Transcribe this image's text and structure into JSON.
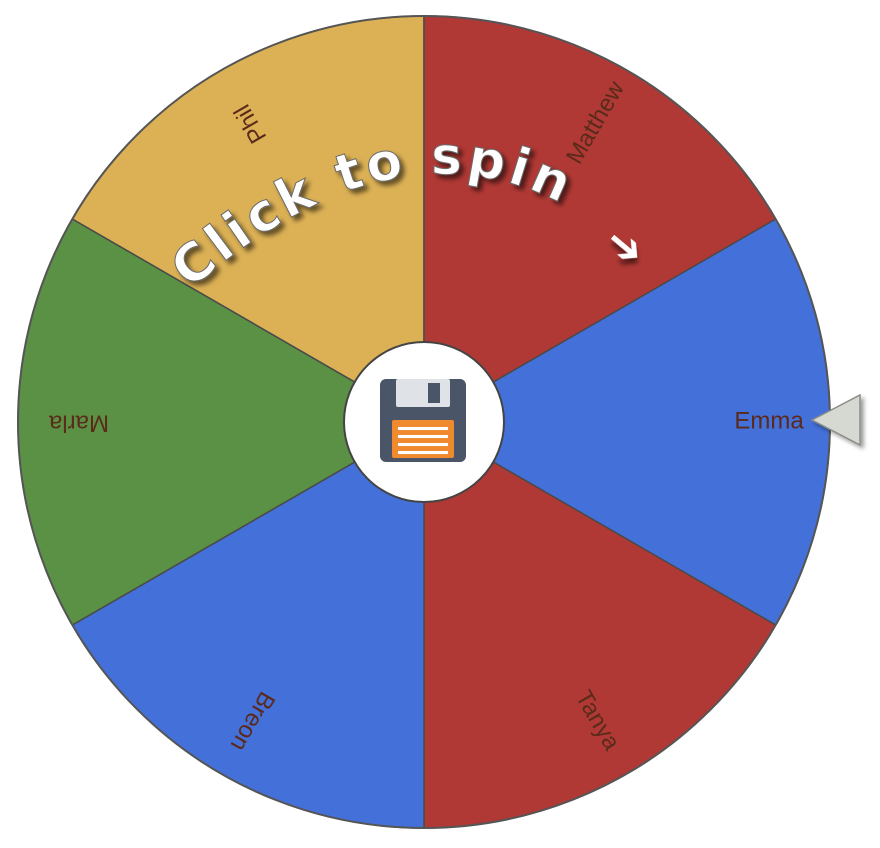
{
  "wheel": {
    "segments": [
      {
        "label": "Emma",
        "color": "#4470d9"
      },
      {
        "label": "Tanya",
        "color": "#b13935"
      },
      {
        "label": "Breon",
        "color": "#4470d9"
      },
      {
        "label": "Marla",
        "color": "#5a9145"
      },
      {
        "label": "Phil",
        "color": "#dcb155"
      },
      {
        "label": "Matthew",
        "color": "#b13935"
      }
    ],
    "label_color": "#5a2a1a",
    "border_color": "#4a4a4a"
  },
  "overlay": {
    "spin_text": "Click to spin",
    "arrow_glyph": "➔"
  },
  "center_button": {
    "icon": "floppy-disk-icon"
  },
  "pointer": {
    "icon": "pointer-arrow-icon",
    "color": "#d6d8d2"
  }
}
